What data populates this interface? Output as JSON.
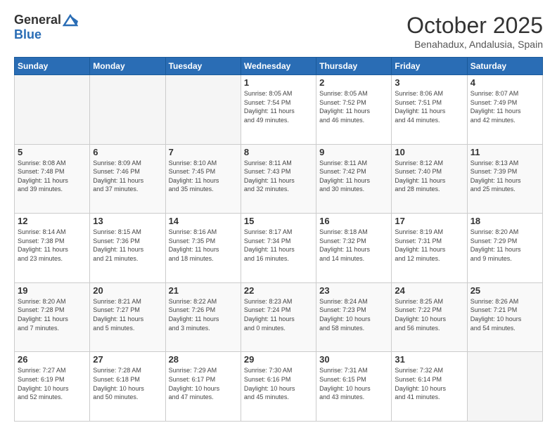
{
  "logo": {
    "general": "General",
    "blue": "Blue"
  },
  "header": {
    "month": "October 2025",
    "location": "Benahadux, Andalusia, Spain"
  },
  "weekdays": [
    "Sunday",
    "Monday",
    "Tuesday",
    "Wednesday",
    "Thursday",
    "Friday",
    "Saturday"
  ],
  "weeks": [
    [
      {
        "day": "",
        "info": ""
      },
      {
        "day": "",
        "info": ""
      },
      {
        "day": "",
        "info": ""
      },
      {
        "day": "1",
        "info": "Sunrise: 8:05 AM\nSunset: 7:54 PM\nDaylight: 11 hours\nand 49 minutes."
      },
      {
        "day": "2",
        "info": "Sunrise: 8:05 AM\nSunset: 7:52 PM\nDaylight: 11 hours\nand 46 minutes."
      },
      {
        "day": "3",
        "info": "Sunrise: 8:06 AM\nSunset: 7:51 PM\nDaylight: 11 hours\nand 44 minutes."
      },
      {
        "day": "4",
        "info": "Sunrise: 8:07 AM\nSunset: 7:49 PM\nDaylight: 11 hours\nand 42 minutes."
      }
    ],
    [
      {
        "day": "5",
        "info": "Sunrise: 8:08 AM\nSunset: 7:48 PM\nDaylight: 11 hours\nand 39 minutes."
      },
      {
        "day": "6",
        "info": "Sunrise: 8:09 AM\nSunset: 7:46 PM\nDaylight: 11 hours\nand 37 minutes."
      },
      {
        "day": "7",
        "info": "Sunrise: 8:10 AM\nSunset: 7:45 PM\nDaylight: 11 hours\nand 35 minutes."
      },
      {
        "day": "8",
        "info": "Sunrise: 8:11 AM\nSunset: 7:43 PM\nDaylight: 11 hours\nand 32 minutes."
      },
      {
        "day": "9",
        "info": "Sunrise: 8:11 AM\nSunset: 7:42 PM\nDaylight: 11 hours\nand 30 minutes."
      },
      {
        "day": "10",
        "info": "Sunrise: 8:12 AM\nSunset: 7:40 PM\nDaylight: 11 hours\nand 28 minutes."
      },
      {
        "day": "11",
        "info": "Sunrise: 8:13 AM\nSunset: 7:39 PM\nDaylight: 11 hours\nand 25 minutes."
      }
    ],
    [
      {
        "day": "12",
        "info": "Sunrise: 8:14 AM\nSunset: 7:38 PM\nDaylight: 11 hours\nand 23 minutes."
      },
      {
        "day": "13",
        "info": "Sunrise: 8:15 AM\nSunset: 7:36 PM\nDaylight: 11 hours\nand 21 minutes."
      },
      {
        "day": "14",
        "info": "Sunrise: 8:16 AM\nSunset: 7:35 PM\nDaylight: 11 hours\nand 18 minutes."
      },
      {
        "day": "15",
        "info": "Sunrise: 8:17 AM\nSunset: 7:34 PM\nDaylight: 11 hours\nand 16 minutes."
      },
      {
        "day": "16",
        "info": "Sunrise: 8:18 AM\nSunset: 7:32 PM\nDaylight: 11 hours\nand 14 minutes."
      },
      {
        "day": "17",
        "info": "Sunrise: 8:19 AM\nSunset: 7:31 PM\nDaylight: 11 hours\nand 12 minutes."
      },
      {
        "day": "18",
        "info": "Sunrise: 8:20 AM\nSunset: 7:29 PM\nDaylight: 11 hours\nand 9 minutes."
      }
    ],
    [
      {
        "day": "19",
        "info": "Sunrise: 8:20 AM\nSunset: 7:28 PM\nDaylight: 11 hours\nand 7 minutes."
      },
      {
        "day": "20",
        "info": "Sunrise: 8:21 AM\nSunset: 7:27 PM\nDaylight: 11 hours\nand 5 minutes."
      },
      {
        "day": "21",
        "info": "Sunrise: 8:22 AM\nSunset: 7:26 PM\nDaylight: 11 hours\nand 3 minutes."
      },
      {
        "day": "22",
        "info": "Sunrise: 8:23 AM\nSunset: 7:24 PM\nDaylight: 11 hours\nand 0 minutes."
      },
      {
        "day": "23",
        "info": "Sunrise: 8:24 AM\nSunset: 7:23 PM\nDaylight: 10 hours\nand 58 minutes."
      },
      {
        "day": "24",
        "info": "Sunrise: 8:25 AM\nSunset: 7:22 PM\nDaylight: 10 hours\nand 56 minutes."
      },
      {
        "day": "25",
        "info": "Sunrise: 8:26 AM\nSunset: 7:21 PM\nDaylight: 10 hours\nand 54 minutes."
      }
    ],
    [
      {
        "day": "26",
        "info": "Sunrise: 7:27 AM\nSunset: 6:19 PM\nDaylight: 10 hours\nand 52 minutes."
      },
      {
        "day": "27",
        "info": "Sunrise: 7:28 AM\nSunset: 6:18 PM\nDaylight: 10 hours\nand 50 minutes."
      },
      {
        "day": "28",
        "info": "Sunrise: 7:29 AM\nSunset: 6:17 PM\nDaylight: 10 hours\nand 47 minutes."
      },
      {
        "day": "29",
        "info": "Sunrise: 7:30 AM\nSunset: 6:16 PM\nDaylight: 10 hours\nand 45 minutes."
      },
      {
        "day": "30",
        "info": "Sunrise: 7:31 AM\nSunset: 6:15 PM\nDaylight: 10 hours\nand 43 minutes."
      },
      {
        "day": "31",
        "info": "Sunrise: 7:32 AM\nSunset: 6:14 PM\nDaylight: 10 hours\nand 41 minutes."
      },
      {
        "day": "",
        "info": ""
      }
    ]
  ]
}
